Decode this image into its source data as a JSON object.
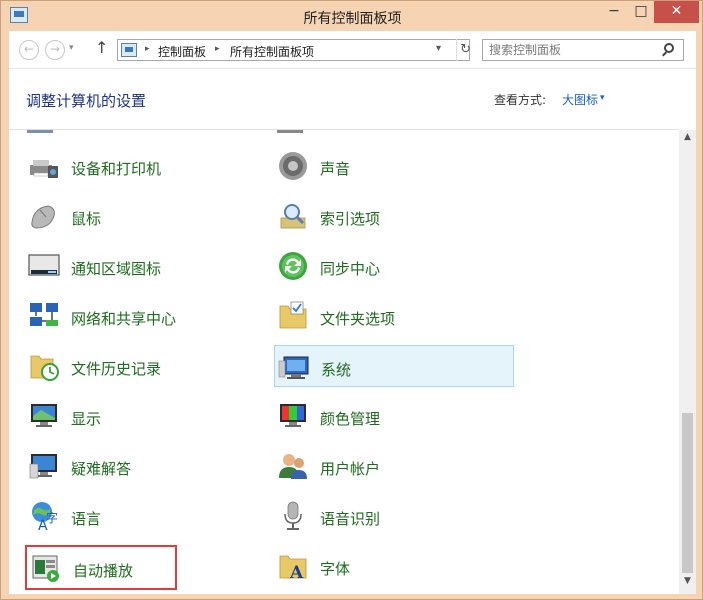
{
  "window": {
    "title": "所有控制面板项"
  },
  "address": {
    "crumbs": [
      "控制面板",
      "所有控制面板项"
    ],
    "search_placeholder": "搜索控制面板"
  },
  "header": {
    "title": "调整计算机的设置",
    "view_label": "查看方式:",
    "view_value": "大图标"
  },
  "icons": {
    "back": "←",
    "forward": "→",
    "up": "↑",
    "dropdown": "▾",
    "refresh": "↻",
    "minimize": "−",
    "maximize": "□",
    "close": "✕",
    "scroll_up": "▲",
    "scroll_down": "▼",
    "separator": "▸"
  },
  "items": [
    {
      "label": "设备和打印机",
      "icon": "printer-icon"
    },
    {
      "label": "声音",
      "icon": "speaker-icon"
    },
    {
      "label": "鼠标",
      "icon": "mouse-icon"
    },
    {
      "label": "索引选项",
      "icon": "indexing-icon"
    },
    {
      "label": "通知区域图标",
      "icon": "notification-icon"
    },
    {
      "label": "同步中心",
      "icon": "sync-icon"
    },
    {
      "label": "网络和共享中心",
      "icon": "network-icon"
    },
    {
      "label": "文件夹选项",
      "icon": "folder-options-icon"
    },
    {
      "label": "文件历史记录",
      "icon": "file-history-icon"
    },
    {
      "label": "系统",
      "icon": "system-icon",
      "selected": true
    },
    {
      "label": "显示",
      "icon": "display-icon"
    },
    {
      "label": "颜色管理",
      "icon": "color-management-icon"
    },
    {
      "label": "疑难解答",
      "icon": "troubleshooting-icon"
    },
    {
      "label": "用户帐户",
      "icon": "user-accounts-icon"
    },
    {
      "label": "语言",
      "icon": "language-icon"
    },
    {
      "label": "语音识别",
      "icon": "microphone-icon"
    },
    {
      "label": "自动播放",
      "icon": "autoplay-icon",
      "highlighted": true
    },
    {
      "label": "字体",
      "icon": "fonts-icon"
    }
  ]
}
